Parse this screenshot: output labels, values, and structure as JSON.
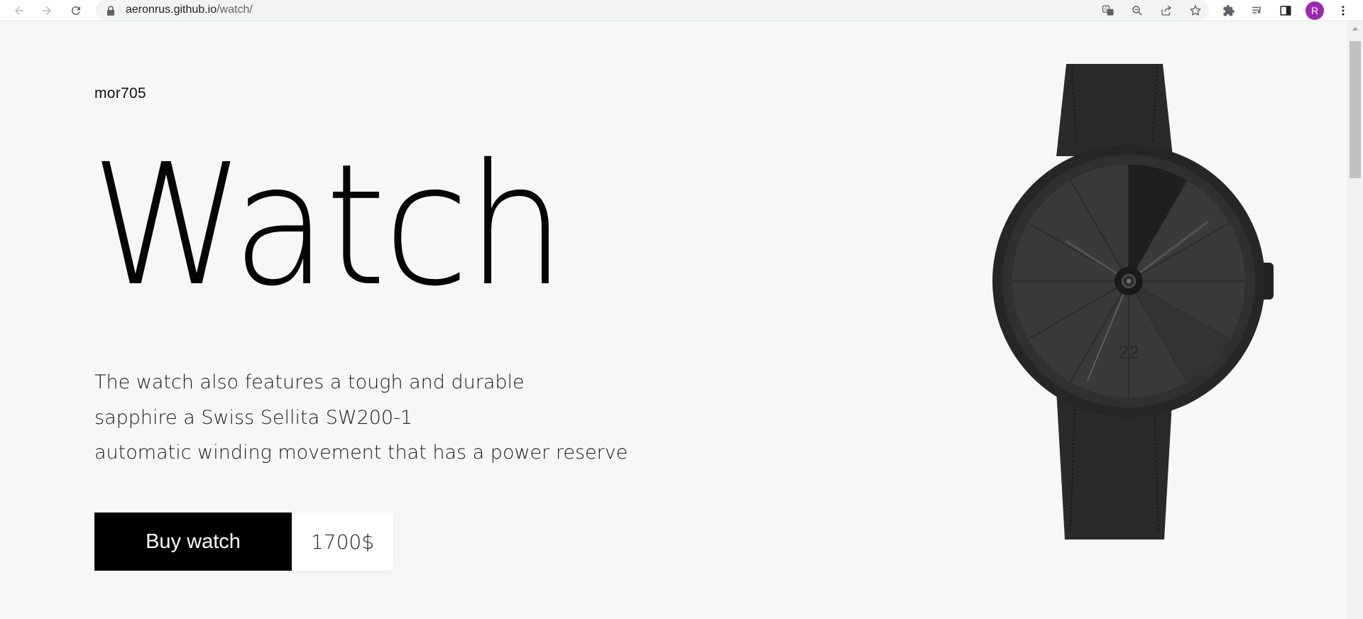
{
  "browser": {
    "url_host": "aeronrus.github.io",
    "url_path": "/watch/",
    "avatar_letter": "R",
    "avatar_color": "#9c27b0",
    "icons": [
      "back-icon",
      "forward-icon",
      "reload-icon",
      "lock-icon",
      "translate-icon",
      "zoom-out-icon",
      "share-icon",
      "bookmark-star-icon",
      "extensions-icon",
      "reading-list-icon",
      "side-panel-icon",
      "menu-kebab-icon"
    ]
  },
  "page": {
    "brand": "mor705",
    "title": "Watch",
    "description": [
      "The watch also features a tough and durable",
      "sapphire a Swiss Sellita SW200-1",
      "automatic winding movement that has a power reserve"
    ],
    "buy_label": "Buy watch",
    "price": "1700$",
    "dial_number": "22",
    "colors": {
      "background": "#f7f7f7",
      "button": "#000000",
      "watch": "#2b2b2b"
    }
  }
}
